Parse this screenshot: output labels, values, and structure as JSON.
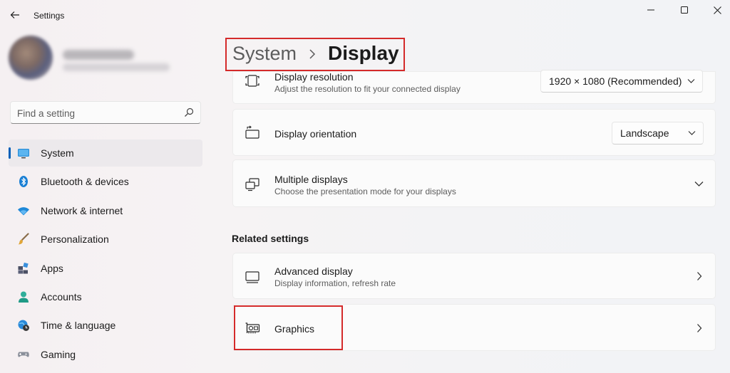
{
  "window": {
    "app_title": "Settings",
    "icons": {
      "back": "back-arrow-icon",
      "minimize": "minimize-icon",
      "maximize": "maximize-icon",
      "close": "close-icon"
    }
  },
  "search": {
    "placeholder": "Find a setting",
    "value": "",
    "icon": "search-icon"
  },
  "sidebar": {
    "items": [
      {
        "label": "System",
        "icon": "monitor-icon",
        "active": true
      },
      {
        "label": "Bluetooth & devices",
        "icon": "bluetooth-icon"
      },
      {
        "label": "Network & internet",
        "icon": "wifi-icon"
      },
      {
        "label": "Personalization",
        "icon": "brush-icon"
      },
      {
        "label": "Apps",
        "icon": "apps-icon"
      },
      {
        "label": "Accounts",
        "icon": "person-icon"
      },
      {
        "label": "Time & language",
        "icon": "globe-clock-icon"
      },
      {
        "label": "Gaming",
        "icon": "gamepad-icon"
      }
    ]
  },
  "header": {
    "parent": "System",
    "current": "Display"
  },
  "cards": {
    "resolution": {
      "title": "Display resolution",
      "subtitle": "Adjust the resolution to fit your connected display",
      "value": "1920 × 1080 (Recommended)"
    },
    "orientation": {
      "title": "Display orientation",
      "value": "Landscape"
    },
    "multiple": {
      "title": "Multiple displays",
      "subtitle": "Choose the presentation mode for your displays"
    }
  },
  "related": {
    "heading": "Related settings",
    "advanced": {
      "title": "Advanced display",
      "subtitle": "Display information, refresh rate"
    },
    "graphics": {
      "title": "Graphics"
    }
  },
  "colors": {
    "accent": "#005fb8",
    "highlight": "#d42a2a"
  }
}
